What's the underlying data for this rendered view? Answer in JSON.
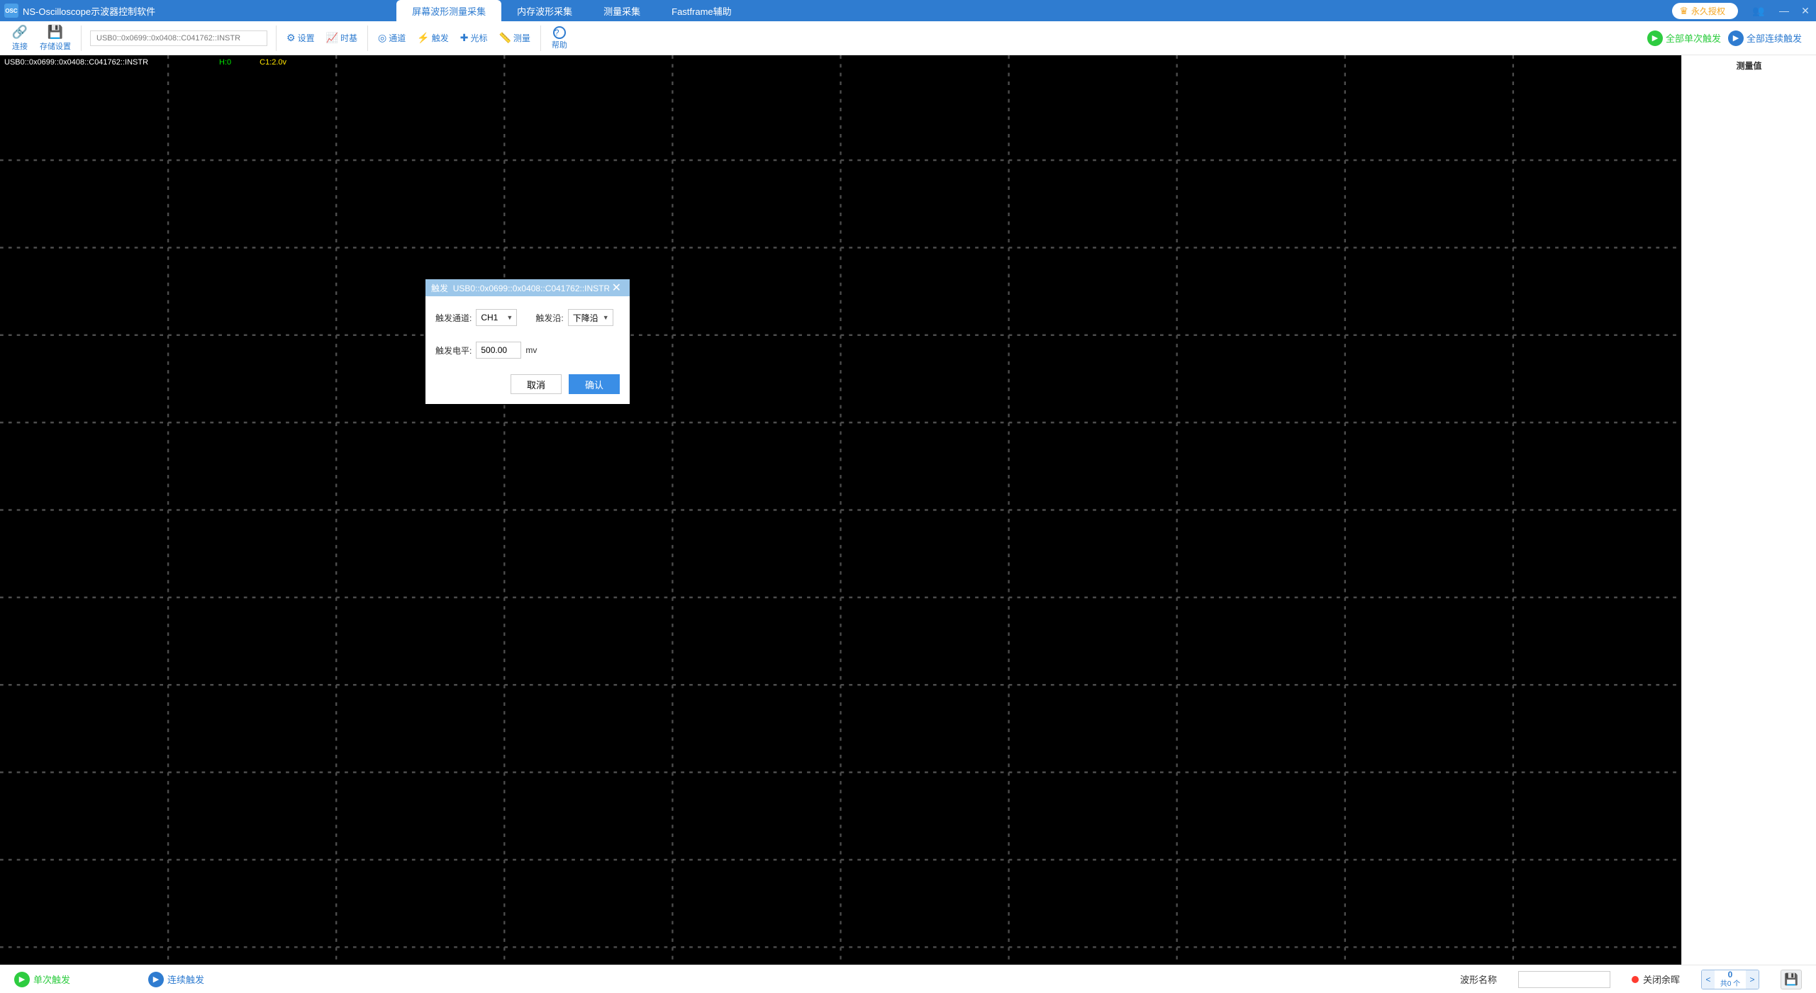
{
  "app": {
    "title": "NS-Oscilloscope示波器控制软件",
    "license_label": "永久授权"
  },
  "tabs": {
    "t0": "屏幕波形测量采集",
    "t1": "内存波形采集",
    "t2": "测量采集",
    "t3": "Fastframe辅助"
  },
  "toolbar": {
    "connect": "连接",
    "storage": "存储设置",
    "address": "USB0::0x0699::0x0408::C041762::INSTR",
    "settings": "设置",
    "timebase": "时基",
    "channel": "通道",
    "trigger": "触发",
    "cursor": "光标",
    "measure": "测量",
    "help": "帮助",
    "all_single": "全部单次触发",
    "all_cont": "全部连续触发"
  },
  "scope": {
    "resource": "USB0::0x0699::0x0408::C041762::INSTR",
    "h_value": "H:0",
    "c1_value": "C1:2.0v"
  },
  "side": {
    "measure_title": "测量值"
  },
  "modal": {
    "title_prefix": "触发",
    "title_resource": "USB0::0x0699::0x0408::C041762::INSTR",
    "channel_label": "触发通道:",
    "channel_value": "CH1",
    "edge_label": "触发沿:",
    "edge_value": "下降沿",
    "level_label": "触发电平:",
    "level_value": "500.00",
    "level_unit": "mv",
    "cancel": "取消",
    "ok": "确认"
  },
  "status": {
    "single": "单次触发",
    "continuous": "连续触发",
    "wf_name_label": "波形名称",
    "wf_name_value": "",
    "persist_label": "关闭余晖",
    "stepper_value": "0",
    "stepper_total": "共0 个"
  }
}
